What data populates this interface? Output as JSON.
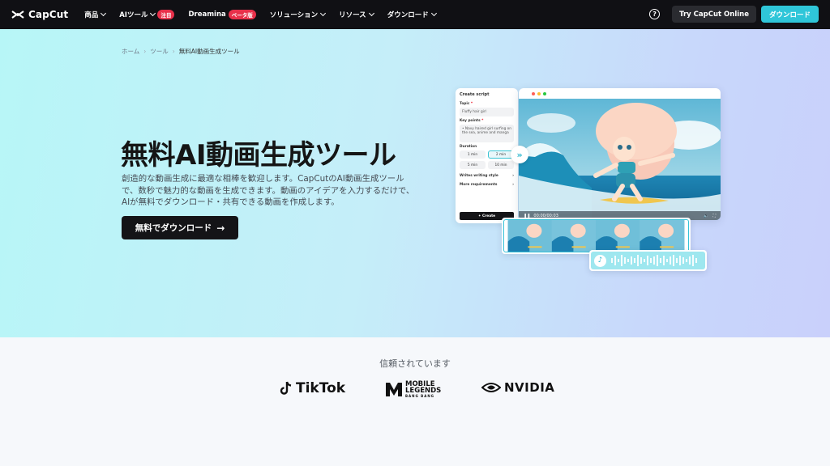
{
  "nav": {
    "logo_text": "CapCut",
    "items": [
      {
        "label": "商品",
        "has_dropdown": true
      },
      {
        "label": "AIツール",
        "badge": "注目",
        "has_dropdown": true
      },
      {
        "label": "Dreamina",
        "badge": "ベータ版",
        "has_dropdown": false
      },
      {
        "label": "ソリューション",
        "has_dropdown": true
      },
      {
        "label": "リソース",
        "has_dropdown": true
      },
      {
        "label": "ダウンロード",
        "has_dropdown": true
      }
    ],
    "help_icon": "question-circle-icon",
    "try_online_label": "Try CapCut Online",
    "download_label": "ダウンロード",
    "colors": {
      "background": "#101014",
      "accent": "#2fc6d9",
      "badge": "#e8304a"
    }
  },
  "breadcrumb": [
    "ホーム",
    "ツール",
    "無料AI動画生成ツール"
  ],
  "hero": {
    "title": "無料AI動画生成ツール",
    "description": "創造的な動画生成に最適な相棒を歓迎します。CapCutのAI動画生成ツールで、数秒で魅力的な動画を生成できます。動画のアイデアを入力するだけで、AIが無料でダウンロード・共有できる動画を作成します。",
    "cta_label": "無料でダウンロード",
    "cta_icon": "arrow-right-icon"
  },
  "script_card": {
    "title": "Create script",
    "topic_label": "Topic",
    "topic_value": "Fluffy hair girl",
    "key_points_label": "Key points",
    "key_points_value": "• Navy haired girl surfing on the sea, anime and manga",
    "duration_label": "Duration",
    "durations": [
      "1 min",
      "2 min",
      "5 min",
      "10 min"
    ],
    "selected_duration": "2 min",
    "writing_style_label": "Writes writing style",
    "more_requirements_label": "More requirements",
    "create_label": "Create"
  },
  "video": {
    "timecode": "00:00/00:03"
  },
  "trusted": {
    "label": "信頼されています",
    "logos": [
      {
        "name": "TikTok",
        "text": "TikTok"
      },
      {
        "name": "Mobile Legends",
        "text_top": "MOBILE",
        "text_bottom": "LEGENDS",
        "sub": "BANG BANG"
      },
      {
        "name": "NVIDIA",
        "text": "NVIDIA"
      }
    ]
  }
}
